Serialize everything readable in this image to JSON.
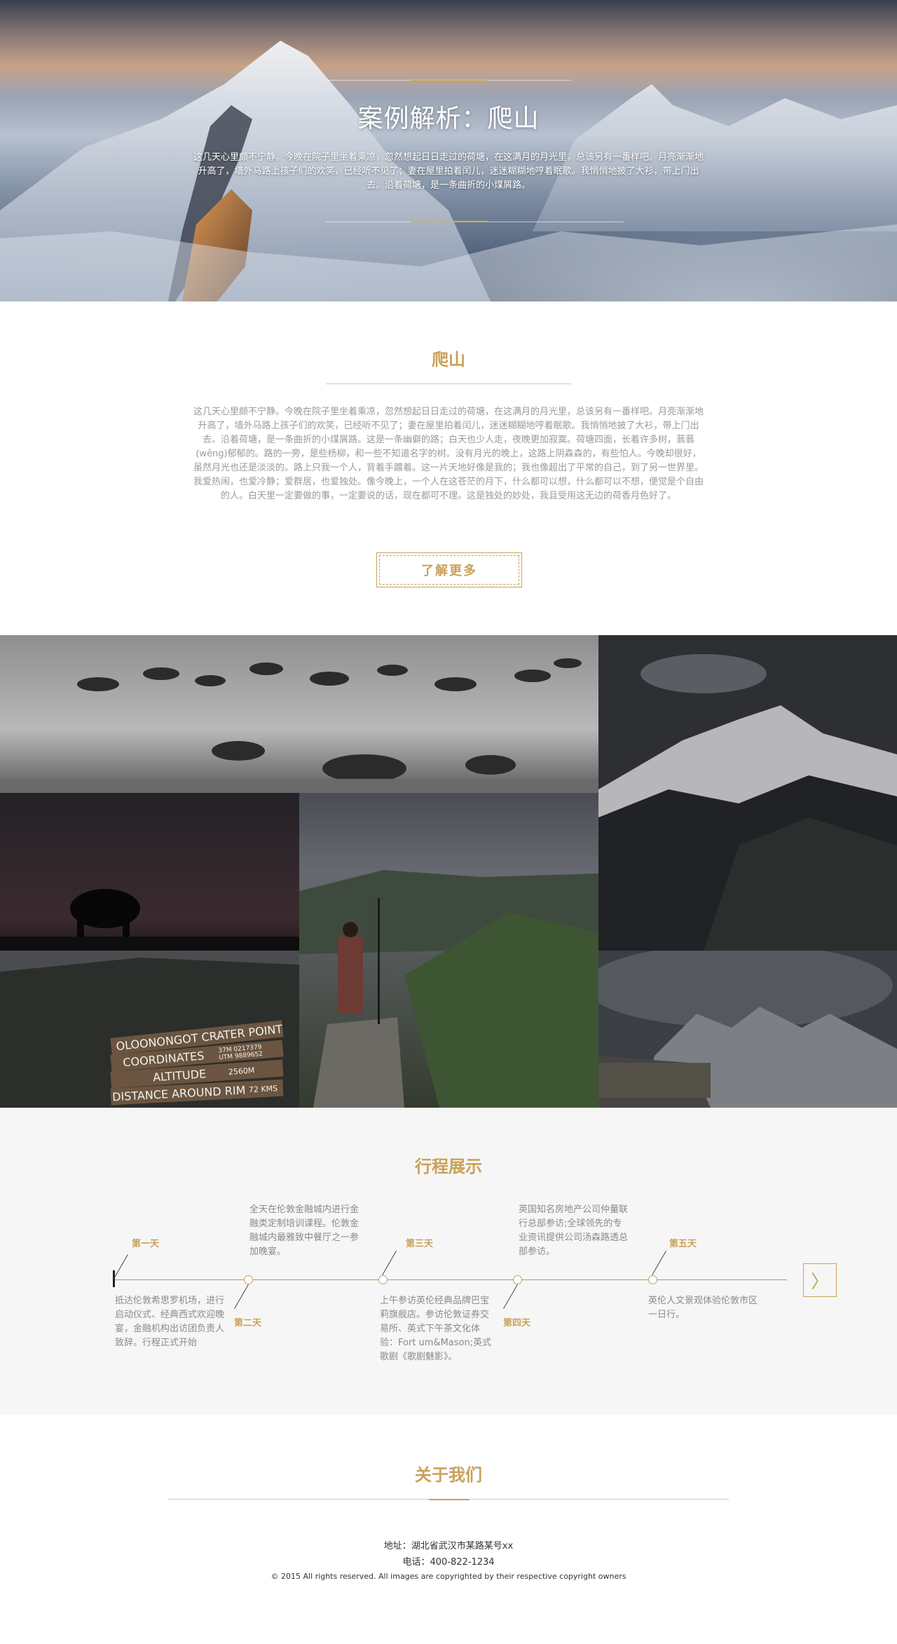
{
  "hero": {
    "title": "案例解析：爬山",
    "text": "这几天心里颇不宁静。今晚在院子里坐着乘凉，忽然想起日日走过的荷塘，在这满月的月光里，总该另有一番样吧。月亮渐渐地升高了，墙外马路上孩子们的欢笑，已经听不见了；妻在屋里拍着闰儿，迷迷糊糊地哼着眠歌。我悄悄地披了大衫，带上门出去。沿着荷塘，是一条曲折的小煤屑路。"
  },
  "intro": {
    "title": "爬山",
    "text": "这几天心里颇不宁静。今晚在院子里坐着乘凉，忽然想起日日走过的荷塘，在这满月的月光里，总该另有一番样吧。月亮渐渐地升高了，墙外马路上孩子们的欢笑，已经听不见了；妻在屋里拍着闰儿，迷迷糊糊地哼着眠歌。我悄悄地披了大衫，带上门出去。沿着荷塘，是一条曲折的小煤屑路。这是一条幽僻的路；白天也少人走，夜晚更加寂寞。荷塘四面，长着许多树，蓊蓊(wěng)郁郁的。路的一旁，是些杨柳，和一些不知道名字的树。没有月光的晚上，这路上阴森森的，有些怕人。今晚却很好，虽然月光也还是淡淡的。路上只我一个人，背着手踱着。这一片天地好像是我的；我也像超出了平常的自己，到了另一世界里。我爱热闹，也爱冷静；爱群居，也爱独处。像今晚上，一个人在这苍茫的月下，什么都可以想，什么都可以不想，便觉是个自由的人。白天里一定要做的事，一定要说的话，现在都可不理。这是独处的妙处，我且受用这无边的荷香月色好了。",
    "button": "了解更多"
  },
  "gallery": {
    "sign_lines": [
      "OLOONONGOT CRATER POINT",
      "COORDINATES",
      "37M 0217379",
      "UTM 9889652",
      "ALTITUDE",
      "2560M",
      "DISTANCE AROUND RIM",
      "72 KMS"
    ]
  },
  "timeline": {
    "title": "行程展示",
    "days": [
      {
        "label": "第一天",
        "desc": "抵达伦敦希思罗机场，进行启动仪式、经典西式欢迎晚宴，金融机构出访团负责人致辞。行程正式开始"
      },
      {
        "label": "第二天",
        "desc": "全天在伦敦金融城内进行金融类定制培训课程。伦敦金融城内最雅致中餐厅之一参加晚宴。"
      },
      {
        "label": "第三天",
        "desc": "上午参访英伦经典品牌巴宝莉旗舰店。参访伦敦证券交易所、英式下午茶文化体验：Fort um&Mason;英式歌剧《歌剧魅影》。"
      },
      {
        "label": "第四天",
        "desc": "英国知名房地产公司仲量联行总部参访;全球领先的专业资讯提供公司汤森路透总部参访。"
      },
      {
        "label": "第五天",
        "desc": "英伦人文景观体验伦敦市区一日行。"
      }
    ],
    "next_icon": "chevron-right-icon",
    "next_glyph": "〉"
  },
  "about": {
    "title": "关于我们",
    "address": "地址：湖北省武汉市某路某号xx",
    "phone": "电话：400-822-1234",
    "copyright": "© 2015 All rights reserved. All images are copyrighted by their respective copyright owners"
  },
  "colors": {
    "accent": "#c9a15a",
    "timeline_bg": "#f6f6f6"
  }
}
